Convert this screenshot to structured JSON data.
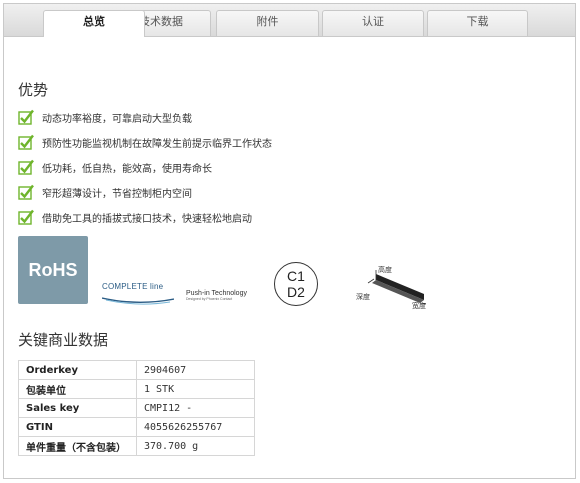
{
  "tabs": [
    {
      "label": "总览",
      "active": true
    },
    {
      "label": "技术数据",
      "active": false
    },
    {
      "label": "附件",
      "active": false
    },
    {
      "label": "认证",
      "active": false
    },
    {
      "label": "下载",
      "active": false
    }
  ],
  "advantages": {
    "title": "优势",
    "items": [
      "动态功率裕度，可靠启动大型负载",
      "预防性功能监视机制在故障发生前提示临界工作状态",
      "低功耗，低自热，能效高，使用寿命长",
      "窄形超薄设计，节省控制柜内空间",
      "借助免工具的插拔式接口技术，快速轻松地启动"
    ]
  },
  "logos": {
    "rohs": "RoHS",
    "complete_line": "COMPLETE line",
    "push_in": "Push-in Technology",
    "push_in_sub": "Designed by Phoenix Contact",
    "c1": "C1",
    "d2": "D2",
    "dim_height": "高度",
    "dim_depth": "深度",
    "dim_width": "宽度"
  },
  "commercial": {
    "title": "关键商业数据",
    "rows": [
      {
        "key": "Orderkey",
        "value": "2904607"
      },
      {
        "key": "包装单位",
        "value": "1 STK"
      },
      {
        "key": "Sales key",
        "value": "CMPI12 -"
      },
      {
        "key": "GTIN",
        "value": "4055626255767"
      },
      {
        "key": "单件重量（不含包装）",
        "value": "370.700 g"
      }
    ]
  },
  "colors": {
    "check_green": "#6fb52c",
    "rohs_bg": "#7e9aa8",
    "complete_line_blue": "#2b5c85"
  }
}
